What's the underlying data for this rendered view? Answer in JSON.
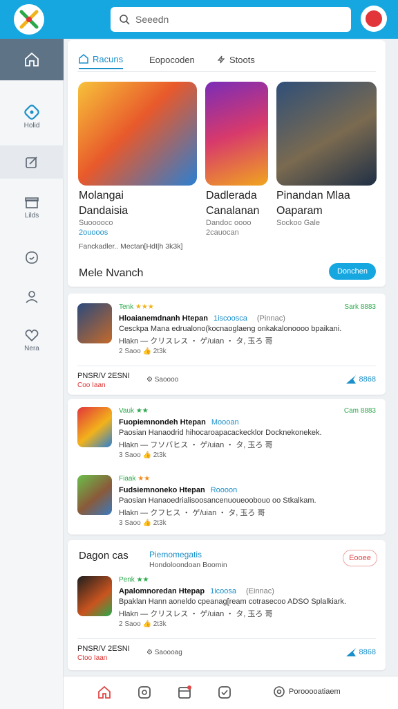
{
  "header": {
    "search_placeholder": "Seeedn"
  },
  "sidebar": {
    "items": [
      {
        "icon": "home-icon",
        "label": ""
      },
      {
        "icon": "gamepad-icon",
        "label": "Holid"
      },
      {
        "icon": "edit-icon",
        "label": ""
      },
      {
        "icon": "gift-icon",
        "label": "Lilds"
      },
      {
        "icon": "chat-icon",
        "label": ""
      },
      {
        "icon": "user-icon",
        "label": ""
      },
      {
        "icon": "heart-icon",
        "label": "Nera"
      }
    ]
  },
  "tabs": [
    {
      "label": "Racuns",
      "icon": "home-icon"
    },
    {
      "label": "Eopocoden",
      "icon": ""
    },
    {
      "label": "Stoots",
      "icon": "bolt-icon"
    }
  ],
  "featured": [
    {
      "title_1": "Molangai",
      "title_2": "Dandaisia",
      "sub": "Suooooco",
      "price": "2ouooos"
    },
    {
      "title_1": "Dadlerada",
      "title_2": "Canalanan",
      "sub": "Dandoc oooo",
      "price": "2cauocan"
    },
    {
      "title_1": "Pinandan Mlaa",
      "title_2": "Oaparam",
      "sub": "Sockoo Gale",
      "price": ""
    }
  ],
  "tags_line": "Fanckadler.. Mectan[HdI|h 3k3k]",
  "more": {
    "title": "Mele Nvanch",
    "button": "Donchen"
  },
  "game_lists": [
    {
      "games": [
        {
          "rating": "Tenk",
          "stars": "★★★",
          "star_style": "gold",
          "name": "Hloaianemdnanh Htepan",
          "tag": "1iscoosca",
          "ext": "(Pinnac)",
          "desc": "Cesckpa Mana edrualono(kocnaoglaeng onkakalonoooo bpaikani.",
          "meta": "Hlakn — クリスレス ・ ゲ/uian ・ タ, 玉ろ 哥",
          "stats": "2 Saoo   👍 2t3k",
          "right": "Sark 8883"
        }
      ],
      "footer": {
        "code": "PNSR/V 2ESNI",
        "code_sub": "Coo Iaan",
        "sec": "Saoooo",
        "share": "8868"
      }
    },
    {
      "games": [
        {
          "rating": "Vauk",
          "stars": "★★",
          "star_style": "green",
          "name": "Fuopiemnondeh Htepan",
          "tag": "Moooan",
          "ext": "",
          "desc": "Paosian Hanaodrid hihocaroapacackecklor Docknekonekek.",
          "meta": "Hlakn — フソバヒス ・ ゲ/uian ・ タ, 玉ろ 哥",
          "stats": "3 Saoo   👍 2t3k",
          "right": "Cam 8883"
        },
        {
          "rating": "Fiaak",
          "stars": "★★",
          "star_style": "orange",
          "name": "Fudsiemnoneko Htepan",
          "tag": "Roooon",
          "ext": "",
          "desc": "Paosian Hanaoedrialisoosancenuoueoobouo oo Stkalkam.",
          "meta": "Hlakn — クフヒス ・ ゲ/uian ・ タ, 玉ろ 哥",
          "stats": "3 Saoo   👍 2t3k",
          "right": ""
        }
      ]
    },
    {
      "header": {
        "title": "Dagon cas",
        "link": "Piemomegatis",
        "sub": "Hondoloondoan Boomin",
        "button": "Eooee"
      },
      "games": [
        {
          "rating": "Penk",
          "stars": "★★",
          "star_style": "green",
          "name": "Apalomnoredan Htepap",
          "tag": "1icoosa",
          "ext": "(Einnac)",
          "desc": "Bpaklan Hann aoneldo cpeanag[ream cotrasecoo ADSO Splalkiark.",
          "meta": "Hlakn — クリスレス ・ ゲ/uian ・ タ, 玉ろ 哥",
          "stats": "2 Saoo   👍 2t3k",
          "right": ""
        }
      ],
      "footer": {
        "code": "PNSR/V 2ESNI",
        "code_sub": "Ctoo Iaan",
        "sec": "Saoooag",
        "share": "8868"
      }
    }
  ],
  "bottom_bar": {
    "label": "Porooooatiaem"
  },
  "colors": {
    "accent": "#17a7e0",
    "link": "#1a8fc9",
    "rating_green": "#2aa84a",
    "danger": "#e04646"
  }
}
